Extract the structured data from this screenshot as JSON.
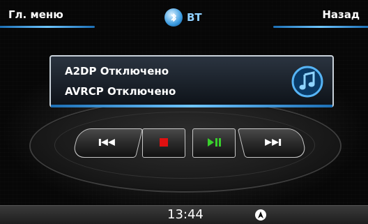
{
  "header": {
    "menu_label": "Гл. меню",
    "title": "BT",
    "back_label": "Назад"
  },
  "status": {
    "a2dp": "A2DP Отключено",
    "avrcp": "AVRCP  Отключено"
  },
  "controls": {
    "prev_icon": "previous-track-icon",
    "stop_icon": "stop-icon",
    "play_icon": "play-pause-icon",
    "next_icon": "next-track-icon"
  },
  "footer": {
    "time": "13:44",
    "nav_icon": "navigation-arrow-icon"
  },
  "colors": {
    "accent": "#3b9be0",
    "stop": "#e01010",
    "play": "#39d02c"
  }
}
